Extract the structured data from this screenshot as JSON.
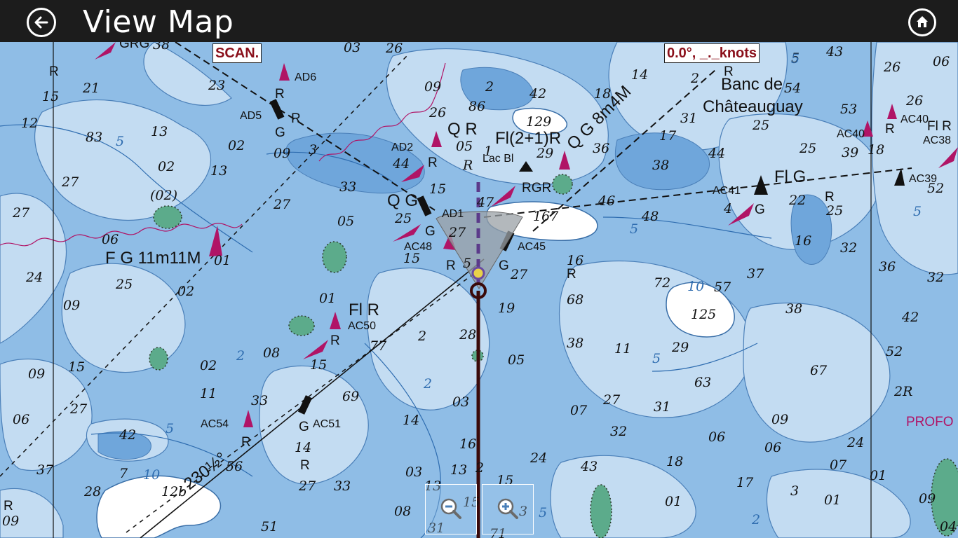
{
  "header": {
    "title": "View Map",
    "back_icon": "arrow-left-icon",
    "home_icon": "home-icon"
  },
  "overlay": {
    "scan_label": "SCAN.",
    "heading_speed": "0.0°, _._knots"
  },
  "zoom": {
    "zoom_out_icon": "zoom-out-icon",
    "zoom_in_icon": "zoom-in-icon"
  },
  "chart_labels": {
    "banc_line1": "Banc de",
    "banc_line2": "Châteauguay",
    "qr": "Q R",
    "fl21r": "Fl(2+1)R",
    "qg8m4m": "Q G 8m4M",
    "lac_bl": "Lac Bl",
    "rgr": "RGR",
    "qg": "Q G",
    "flg": "Fl G",
    "fg11m11m": "F G 11m11M",
    "flr_center": "Fl R",
    "flr_right": "Fl R",
    "bearing": "230½°",
    "profo": "PROFO",
    "ad1": "AD1",
    "ad2": "AD2",
    "ad5": "AD5",
    "ad6": "AD6",
    "ac38": "AC38",
    "ac39": "AC39",
    "ac40": "AC40",
    "ac41": "AC41",
    "ac45": "AC45",
    "ac48": "AC48",
    "ac50": "AC50",
    "ac51": "AC51",
    "ac54": "AC54",
    "grg": "GRG",
    "paren02": "(02)"
  },
  "colors": {
    "topbar": "#1c1c1c",
    "deep_water": "#8fbde6",
    "shoal": "#6fa6db",
    "shallow": "#c3dcf2",
    "land": "#ffffff",
    "buoy_red": "#b01466",
    "label_text": "#8a0f1a",
    "track": "#3a0a0a"
  }
}
